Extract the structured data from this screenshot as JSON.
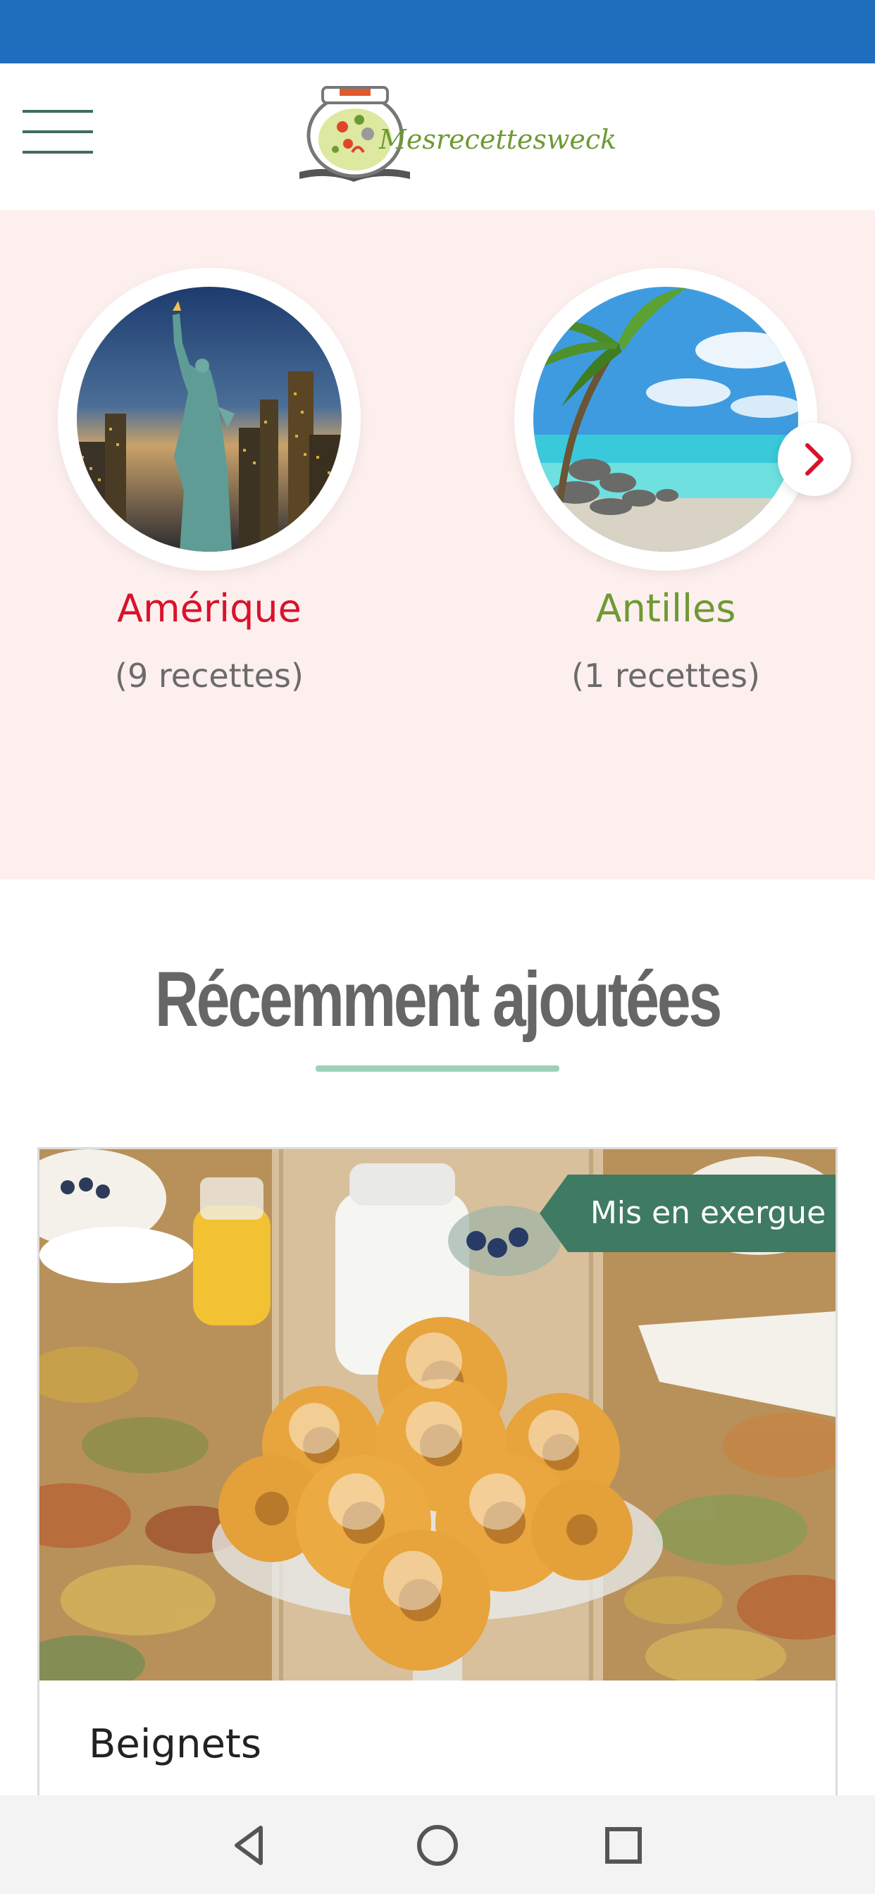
{
  "header": {
    "menu_icon": "hamburger-menu-icon",
    "logo_text": "Mesrecettesweck"
  },
  "regions": [
    {
      "name": "Amérique",
      "count": "(9 recettes)",
      "image": "statue-of-liberty-new-york",
      "color": "#d9122b"
    },
    {
      "name": "Antilles",
      "count": "(1 recettes)",
      "image": "tropical-beach-palm",
      "color": "#6e9a33"
    }
  ],
  "carousel": {
    "next_icon": "chevron-right-icon"
  },
  "recent": {
    "title": "Récemment ajoutées",
    "accent_color": "#9fd0ba"
  },
  "featured_card": {
    "badge": "Mis en exergue",
    "badge_color": "#3f7a63",
    "title": "Beignets",
    "image": "powdered-donuts-on-glass-stand"
  },
  "system_nav": {
    "back_icon": "back-triangle-icon",
    "home_icon": "home-circle-icon",
    "recent_icon": "recent-apps-square-icon"
  },
  "colors": {
    "status_bar": "#1e6ebd",
    "regions_background": "#fdefee"
  }
}
